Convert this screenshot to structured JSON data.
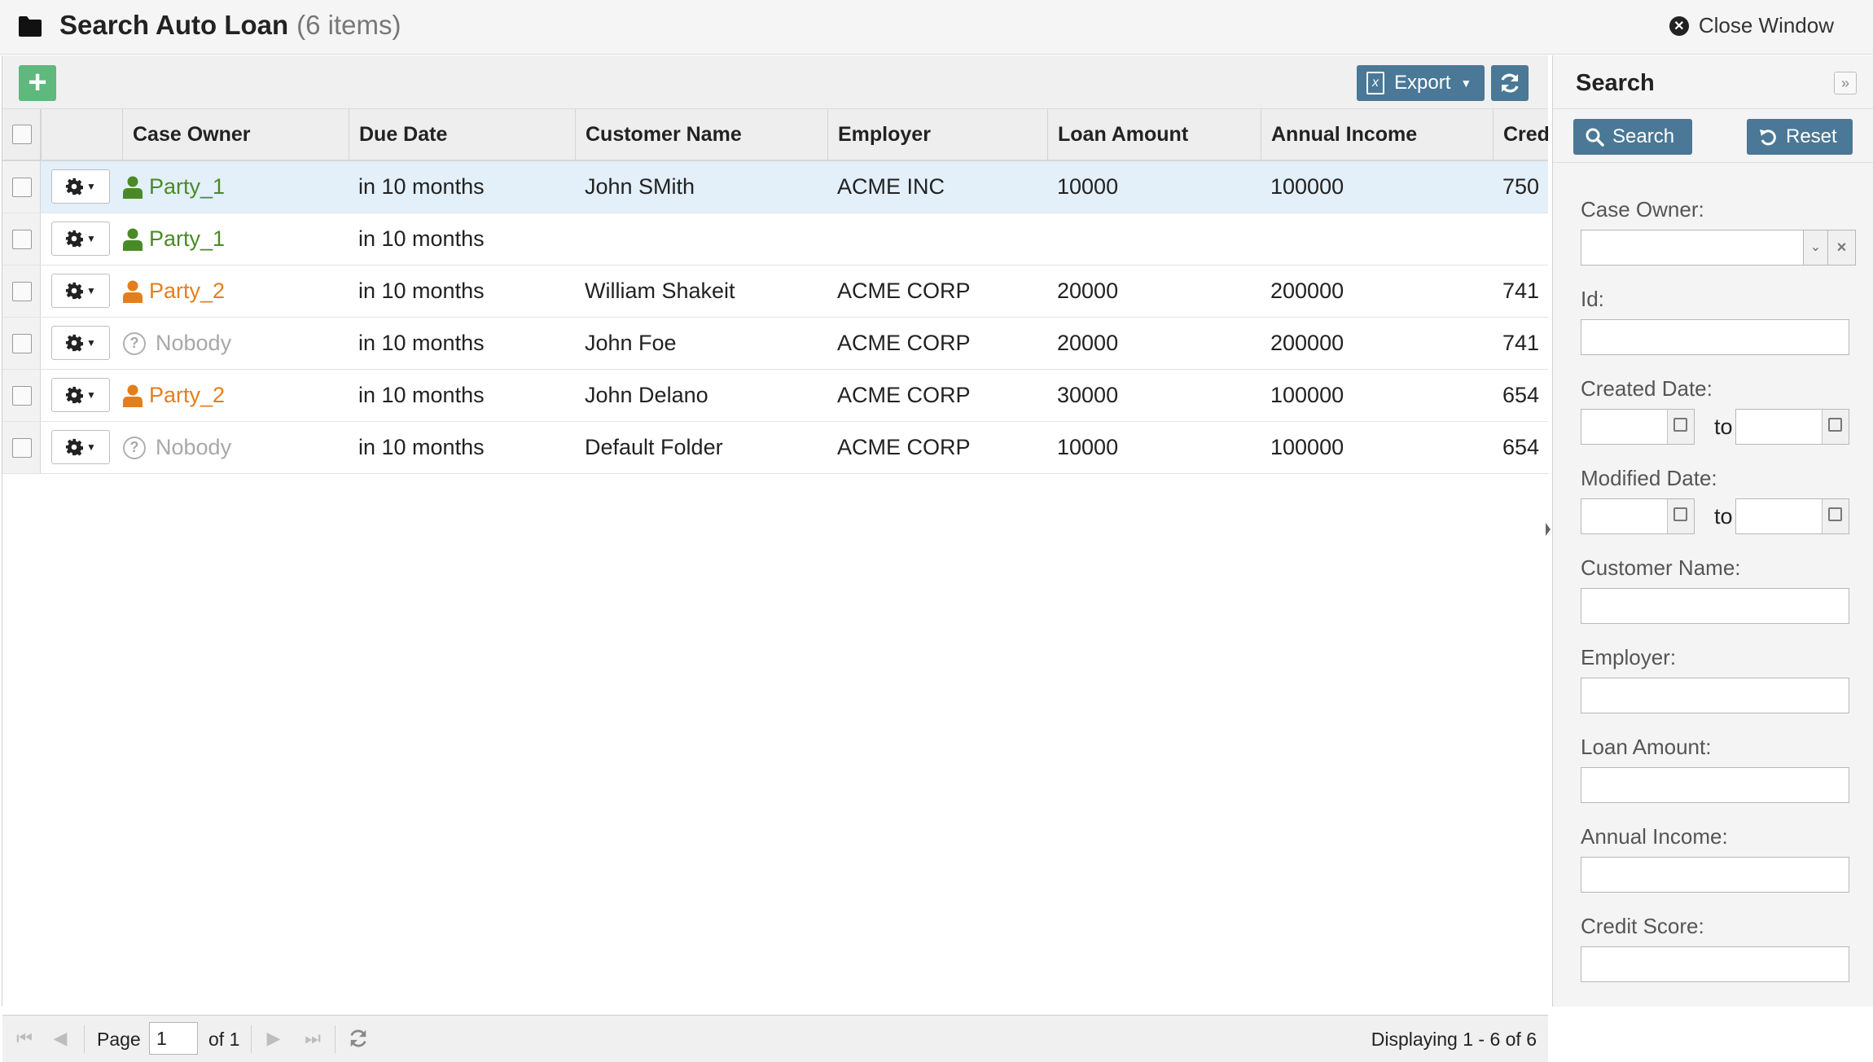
{
  "window": {
    "title": "Search Auto Loan",
    "item_count": "(6 items)",
    "close_label": "Close Window"
  },
  "toolbar": {
    "add_icon": "plus-icon",
    "export_label": "Export",
    "refresh_icon": "refresh-icon"
  },
  "columns": [
    "Case Owner",
    "Due Date",
    "Customer Name",
    "Employer",
    "Loan Amount",
    "Annual Income",
    "Credi"
  ],
  "rows": [
    {
      "owner": "Party_1",
      "owner_color": "#4a8a26",
      "due": "in 10 months",
      "customer": "John SMith",
      "employer": "ACME INC",
      "loan": "10000",
      "income": "100000",
      "credit": "750"
    },
    {
      "owner": "Party_1",
      "owner_color": "#4a8a26",
      "due": "in 10 months",
      "customer": "",
      "employer": "",
      "loan": "",
      "income": "",
      "credit": ""
    },
    {
      "owner": "Party_2",
      "owner_color": "#e47e1c",
      "due": "in 10 months",
      "customer": "William Shakeit",
      "employer": "ACME CORP",
      "loan": "20000",
      "income": "200000",
      "credit": "741"
    },
    {
      "owner": "Nobody",
      "owner_color": "#a8a8a8",
      "due": "in 10 months",
      "customer": "John Foe",
      "employer": "ACME CORP",
      "loan": "20000",
      "income": "200000",
      "credit": "741"
    },
    {
      "owner": "Party_2",
      "owner_color": "#e47e1c",
      "due": "in 10 months",
      "customer": "John Delano",
      "employer": "ACME CORP",
      "loan": "30000",
      "income": "100000",
      "credit": "654"
    },
    {
      "owner": "Nobody",
      "owner_color": "#a8a8a8",
      "due": "in 10 months",
      "customer": "Default Folder",
      "employer": "ACME CORP",
      "loan": "10000",
      "income": "100000",
      "credit": "654"
    }
  ],
  "pager": {
    "page_label": "Page",
    "page_value": "1",
    "of_label": "of 1",
    "display_label": "Displaying 1 - 6 of 6"
  },
  "search_panel": {
    "title": "Search",
    "search_label": "Search",
    "reset_label": "Reset",
    "fields": {
      "case_owner": "Case Owner:",
      "id": "Id:",
      "created_date": "Created Date:",
      "modified_date": "Modified Date:",
      "customer_name": "Customer Name:",
      "employer": "Employer:",
      "loan_amount": "Loan Amount:",
      "annual_income": "Annual Income:",
      "credit_score": "Credit Score:"
    },
    "to_label": "to"
  },
  "colors": {
    "accent": "#4a7896",
    "add_green": "#5fb87c",
    "selected_row": "#e3eff9"
  }
}
